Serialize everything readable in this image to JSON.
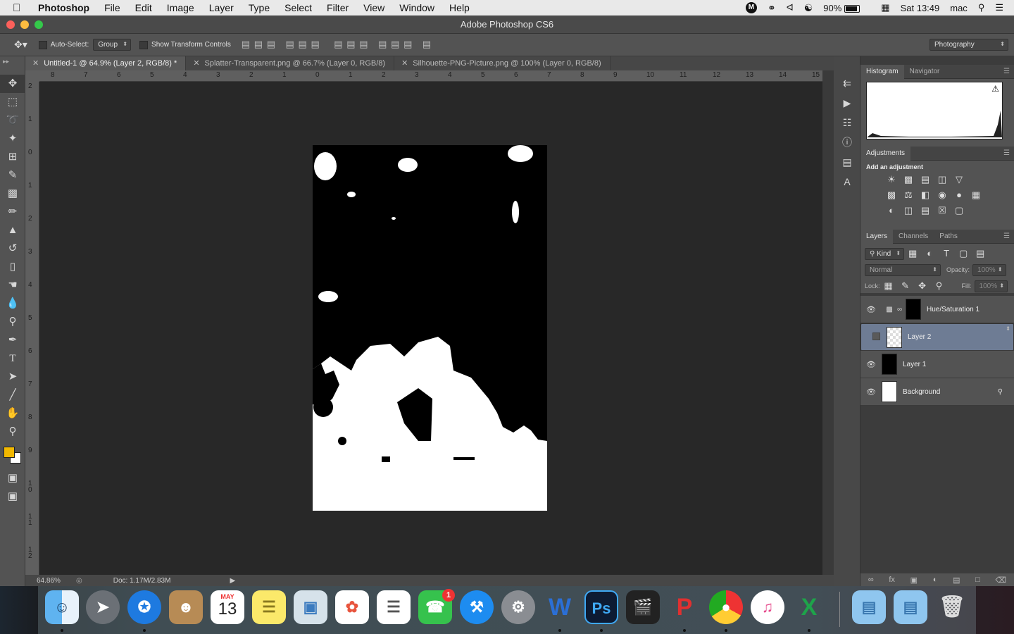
{
  "menubar": {
    "app_name": "Photoshop",
    "items": [
      "File",
      "Edit",
      "Image",
      "Layer",
      "Type",
      "Select",
      "Filter",
      "View",
      "Window",
      "Help"
    ],
    "battery": "90%",
    "datetime": "Sat 13:49",
    "user": "mac"
  },
  "window": {
    "title": "Adobe Photoshop CS6"
  },
  "options": {
    "auto_select_label": "Auto-Select:",
    "auto_select_value": "Group",
    "show_transform_label": "Show Transform Controls",
    "workspace": "Photography"
  },
  "tabs": [
    {
      "label": "Untitled-1 @ 64.9% (Layer 2, RGB/8) *",
      "active": true
    },
    {
      "label": "Splatter-Transparent.png @ 66.7% (Layer 0, RGB/8)",
      "active": false
    },
    {
      "label": "Silhouette-PNG-Picture.png @ 100% (Layer 0, RGB/8)",
      "active": false
    }
  ],
  "hruler_numbers": [
    "8",
    "7",
    "6",
    "5",
    "4",
    "3",
    "2",
    "1",
    "0",
    "1",
    "2",
    "3",
    "4",
    "5",
    "6",
    "7",
    "8",
    "9",
    "10",
    "11",
    "12",
    "13",
    "14",
    "15"
  ],
  "vruler_numbers": [
    "2",
    "1",
    "0",
    "1",
    "2",
    "3",
    "4",
    "5",
    "6",
    "7",
    "8",
    "9",
    "1 0",
    "1 1",
    "1 2"
  ],
  "status": {
    "zoom": "64.86%",
    "doc": "Doc: 1.17M/2.83M"
  },
  "panels": {
    "histogram_tabs": [
      "Histogram",
      "Navigator"
    ],
    "adjustments_title": "Adjustments",
    "add_adjustment": "Add an adjustment",
    "layers_tabs": [
      "Layers",
      "Channels",
      "Paths"
    ],
    "filter_kind": "Kind",
    "blend_mode": "Normal",
    "opacity_label": "Opacity:",
    "opacity_value": "100%",
    "lock_label": "Lock:",
    "fill_label": "Fill:",
    "fill_value": "100%",
    "layers": [
      {
        "name": "Hue/Saturation 1",
        "visible": true,
        "selected": false
      },
      {
        "name": "Layer 2",
        "visible": false,
        "selected": true
      },
      {
        "name": "Layer 1",
        "visible": true,
        "selected": false
      },
      {
        "name": "Background",
        "visible": true,
        "selected": false,
        "locked": true
      }
    ]
  },
  "dock": {
    "calendar_month": "MAY",
    "calendar_day": "13",
    "facetime_badge": "1",
    "app_labels": [
      "Finder",
      "Launchpad",
      "Safari",
      "Contacts",
      "Calendar",
      "Notes",
      "Preview",
      "Photos",
      "Reminders",
      "FaceTime",
      "App Store",
      "System Preferences",
      "Word",
      "Ps",
      "Final Cut Pro",
      "WPS",
      "Chrome",
      "iTunes",
      "Excel",
      "Downloads",
      "Documents",
      "Trash"
    ]
  },
  "colors": {
    "foreground": "#f2b800",
    "background": "#ffffff",
    "selection": "#6e7c94"
  }
}
